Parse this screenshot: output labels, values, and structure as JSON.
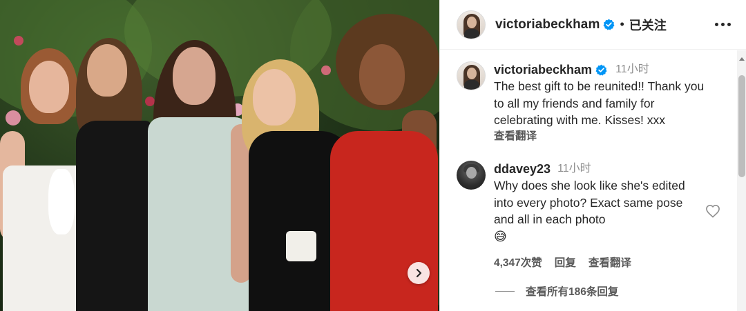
{
  "post": {
    "username": "victoriabeckham",
    "verified": true,
    "separator": "•",
    "follow_state": "已关注",
    "more_icon": "more-horizontal-icon"
  },
  "caption": {
    "username": "victoriabeckham",
    "time": "11小时",
    "text": "The best gift to be reunited!! Thank you to all my friends and family for celebrating with me. Kisses! xxx",
    "translate_label": "查看翻译"
  },
  "comment": {
    "username": "ddavey23",
    "time": "11小时",
    "text": "Why does she look like she's edited into every photo? Exact same pose and all in each photo",
    "emoji": "😅",
    "likes": "4,347次赞",
    "reply_label": "回复",
    "translate_label": "查看翻译",
    "view_replies": "查看所有186条回复"
  },
  "colors": {
    "text_primary": "#262626",
    "text_secondary": "#8e8e8e",
    "verified_blue": "#0095f6",
    "border": "#efefef"
  }
}
